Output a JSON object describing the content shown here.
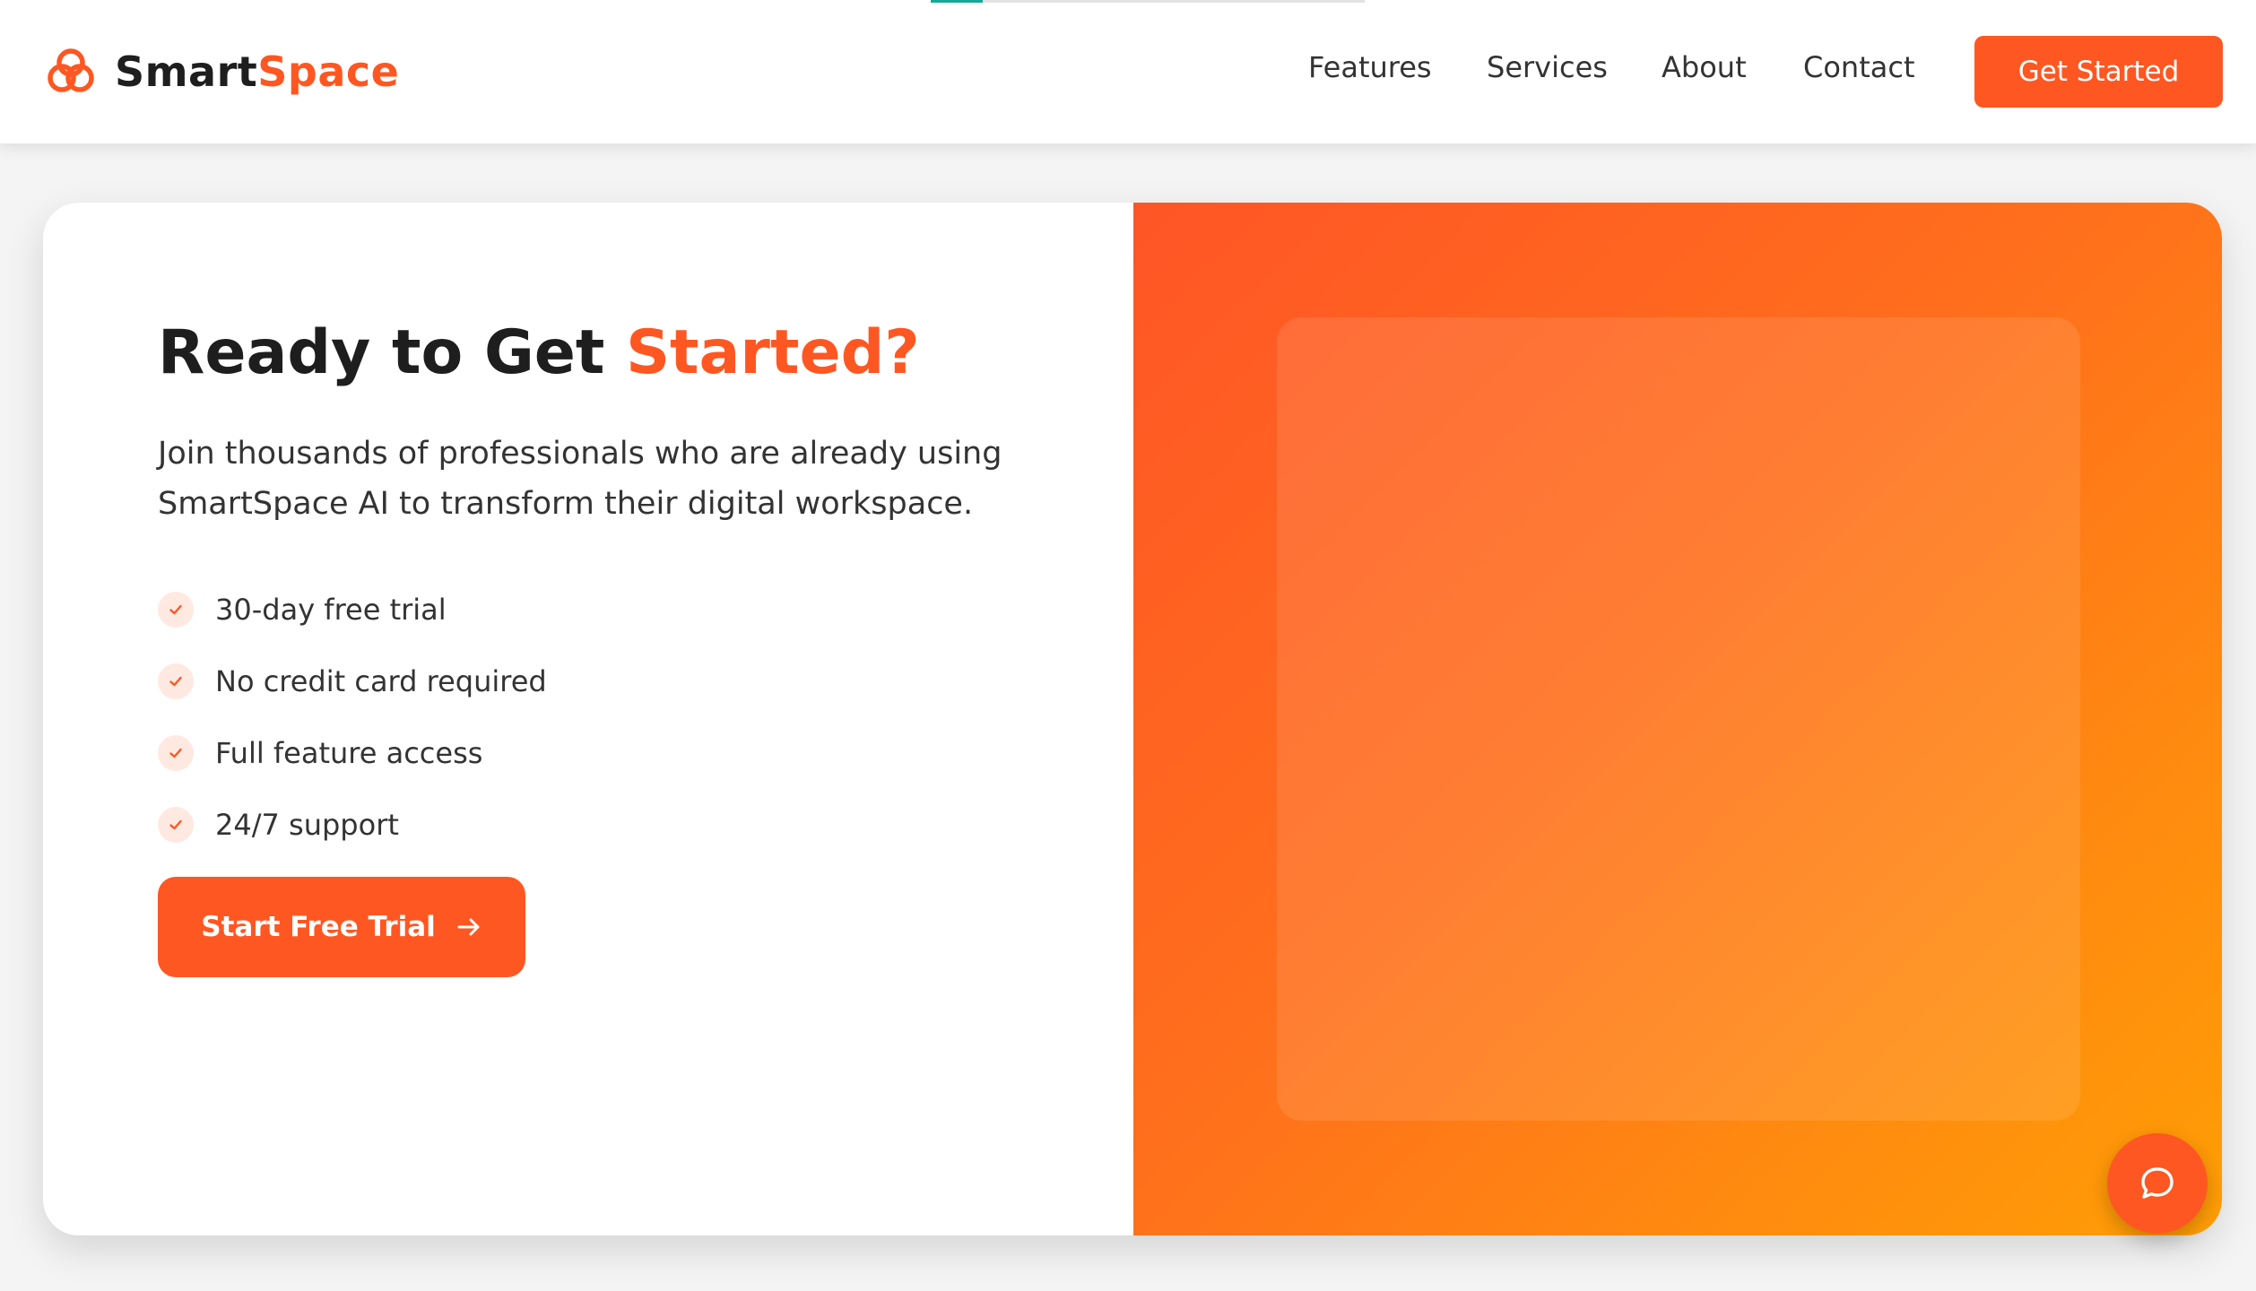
{
  "header": {
    "brand": {
      "name_primary": "Smart",
      "name_accent": "Space"
    },
    "nav": [
      {
        "label": "Features"
      },
      {
        "label": "Services"
      },
      {
        "label": "About"
      },
      {
        "label": "Contact"
      }
    ],
    "cta_label": "Get Started",
    "scroll_progress": 0.12
  },
  "hero": {
    "headline_main": "Ready to Get ",
    "headline_accent": "Started?",
    "lead": "Join thousands of professionals who are already using SmartSpace AI to transform their digital workspace.",
    "features": [
      {
        "label": "30-day free trial",
        "icon": "check-icon"
      },
      {
        "label": "No credit card required",
        "icon": "check-icon"
      },
      {
        "label": "Full feature access",
        "icon": "check-icon"
      },
      {
        "label": "24/7 support",
        "icon": "check-icon"
      }
    ],
    "cta_label": "Start Free Trial"
  },
  "chat_widget": {
    "icon": "chat-bubble-icon"
  },
  "colors": {
    "accent": "#ff5722",
    "accent_gradient_end": "#ff9e05",
    "progress": "#16a99a",
    "text_dark": "#1e1e1e",
    "check_bg": "#ffe9e1"
  }
}
